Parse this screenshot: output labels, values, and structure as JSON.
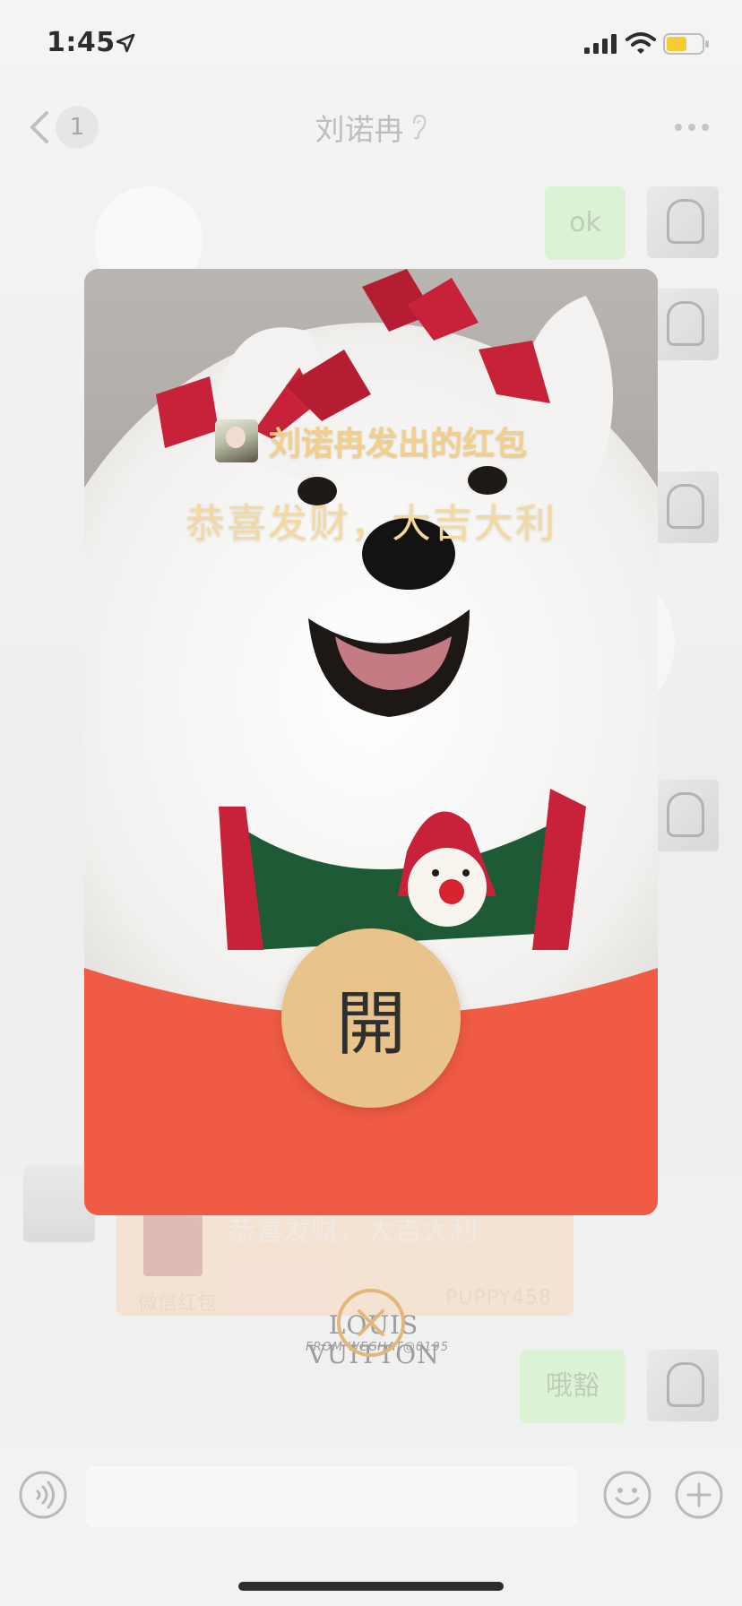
{
  "status_bar": {
    "time": "1:45"
  },
  "nav": {
    "back_count": "1",
    "title": "刘诺冉"
  },
  "chat": {
    "messages": [
      {
        "side": "right",
        "text": "ok"
      },
      {
        "side": "left",
        "type": "red-packet",
        "text": "恭喜发财，大吉大利",
        "packet_type": "微信红包",
        "sender_id": "PUPPY458"
      },
      {
        "side": "right",
        "text": "哦豁"
      }
    ],
    "sticker_text": "LOUIS VUITTON",
    "sticker_subtext": "FROM WECHAT@0195"
  },
  "red_packet_modal": {
    "sender_title": "刘诺冉发出的红包",
    "greeting": "恭喜发财，大吉大利",
    "open_label": "開"
  },
  "colors": {
    "packet_red": "#ef5b45",
    "open_button_gold": "#e8c38c",
    "title_gold": "#f2cf8a",
    "bubble_green": "#d8f1cf"
  },
  "icons": [
    "location-arrow-icon",
    "signal-icon",
    "wifi-icon",
    "battery-icon",
    "back-chevron-icon",
    "ear-icon",
    "more-icon",
    "voice-icon",
    "emoji-icon",
    "plus-icon",
    "close-icon"
  ]
}
